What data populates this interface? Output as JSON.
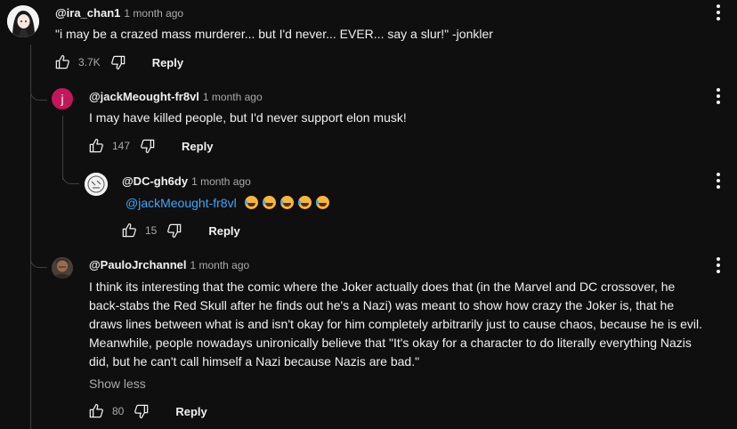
{
  "comments": [
    {
      "author": "@ira_chan1",
      "time": "1 month ago",
      "text": "\"i may be a crazed mass murderer... but I'd never... EVER... say a slur!\" -jonkler",
      "likes": "3.7K",
      "reply_label": "Reply"
    },
    {
      "author": "@jackMeought-fr8vl",
      "time": "1 month ago",
      "avatar_letter": "j",
      "text": "I may have killed people, but I'd never support elon musk!",
      "likes": "147",
      "reply_label": "Reply"
    },
    {
      "author": "@DC-gh6dy",
      "time": "1 month ago",
      "mention": "@jackMeought-fr8vl",
      "emoji_name": "rolling-on-floor-laughing-emoji",
      "likes": "15",
      "reply_label": "Reply"
    },
    {
      "author": "@PauloJrchannel",
      "time": "1 month ago",
      "text_lines": [
        "I think its interesting that the comic where the Joker actually does that (in the Marvel and DC crossover, he",
        "back-stabs the Red Skull after he finds out he's a Nazi) was meant to show how crazy the Joker is, that he",
        "draws lines between what is and isn't okay for him completely arbitrarily just to cause chaos, because he is evil.",
        "Meanwhile, people nowadays unironically believe that \"It's okay for a character to do literally everything Nazis",
        "did, but he can't call himself a Nazi because Nazis are bad.\""
      ],
      "show_less": "Show less",
      "likes": "80",
      "reply_label": "Reply"
    }
  ],
  "colors": {
    "background": "#0f0f0f",
    "text": "#f1f1f1",
    "secondary": "#aaaaaa",
    "link": "#3ea6ff",
    "avatar_j": "#c2185b"
  }
}
